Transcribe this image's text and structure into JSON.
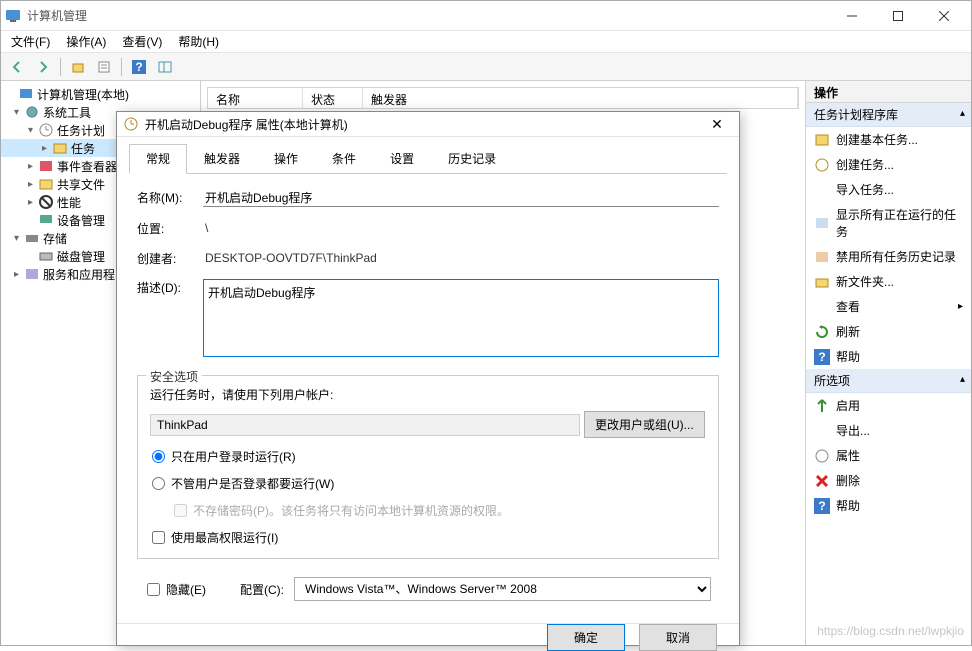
{
  "window": {
    "title": "计算机管理",
    "menus": [
      "文件(F)",
      "操作(A)",
      "查看(V)",
      "帮助(H)"
    ]
  },
  "tree": {
    "root": "计算机管理(本地)",
    "sys_tools": "系统工具",
    "task_sched": "任务计划",
    "task_lib": "任务",
    "event_viewer": "事件查看器",
    "shared": "共享文件",
    "perf": "性能",
    "devmgr": "设备管理",
    "storage": "存储",
    "diskmgr": "磁盘管理",
    "services": "服务和应用程"
  },
  "list": {
    "col_name": "名称",
    "col_status": "状态",
    "col_trigger": "触发器"
  },
  "actions": {
    "header": "操作",
    "section1": "任务计划程序库",
    "items1": [
      "创建基本任务...",
      "创建任务...",
      "导入任务...",
      "显示所有正在运行的任务",
      "禁用所有任务历史记录",
      "新文件夹...",
      "查看",
      "刷新",
      "帮助"
    ],
    "section2": "所选项",
    "items2": [
      "启用",
      "导出...",
      "属性",
      "删除",
      "帮助"
    ]
  },
  "dialog": {
    "title": "开机启动Debug程序 属性(本地计算机)",
    "tabs": [
      "常规",
      "触发器",
      "操作",
      "条件",
      "设置",
      "历史记录"
    ],
    "labels": {
      "name": "名称(M):",
      "location": "位置:",
      "creator": "创建者:",
      "description": "描述(D):"
    },
    "values": {
      "name": "开机启动Debug程序",
      "location": "\\",
      "creator": "DESKTOP-OOVTD7F\\ThinkPad",
      "description": "开机启动Debug程序"
    },
    "security": {
      "legend": "安全选项",
      "use_account_label": "运行任务时，请使用下列用户帐户:",
      "account": "ThinkPad",
      "change_user_btn": "更改用户或组(U)...",
      "radio_logged_on": "只在用户登录时运行(R)",
      "radio_any": "不管用户是否登录都要运行(W)",
      "no_store_pwd": "不存储密码(P)。该任务将只有访问本地计算机资源的权限。",
      "highest_priv": "使用最高权限运行(I)"
    },
    "bottom": {
      "hidden": "隐藏(E)",
      "config_label": "配置(C):",
      "config_value": "Windows Vista™、Windows Server™ 2008"
    },
    "buttons": {
      "ok": "确定",
      "cancel": "取消"
    }
  },
  "watermark": "https://blog.csdn.net/lwpkjio"
}
